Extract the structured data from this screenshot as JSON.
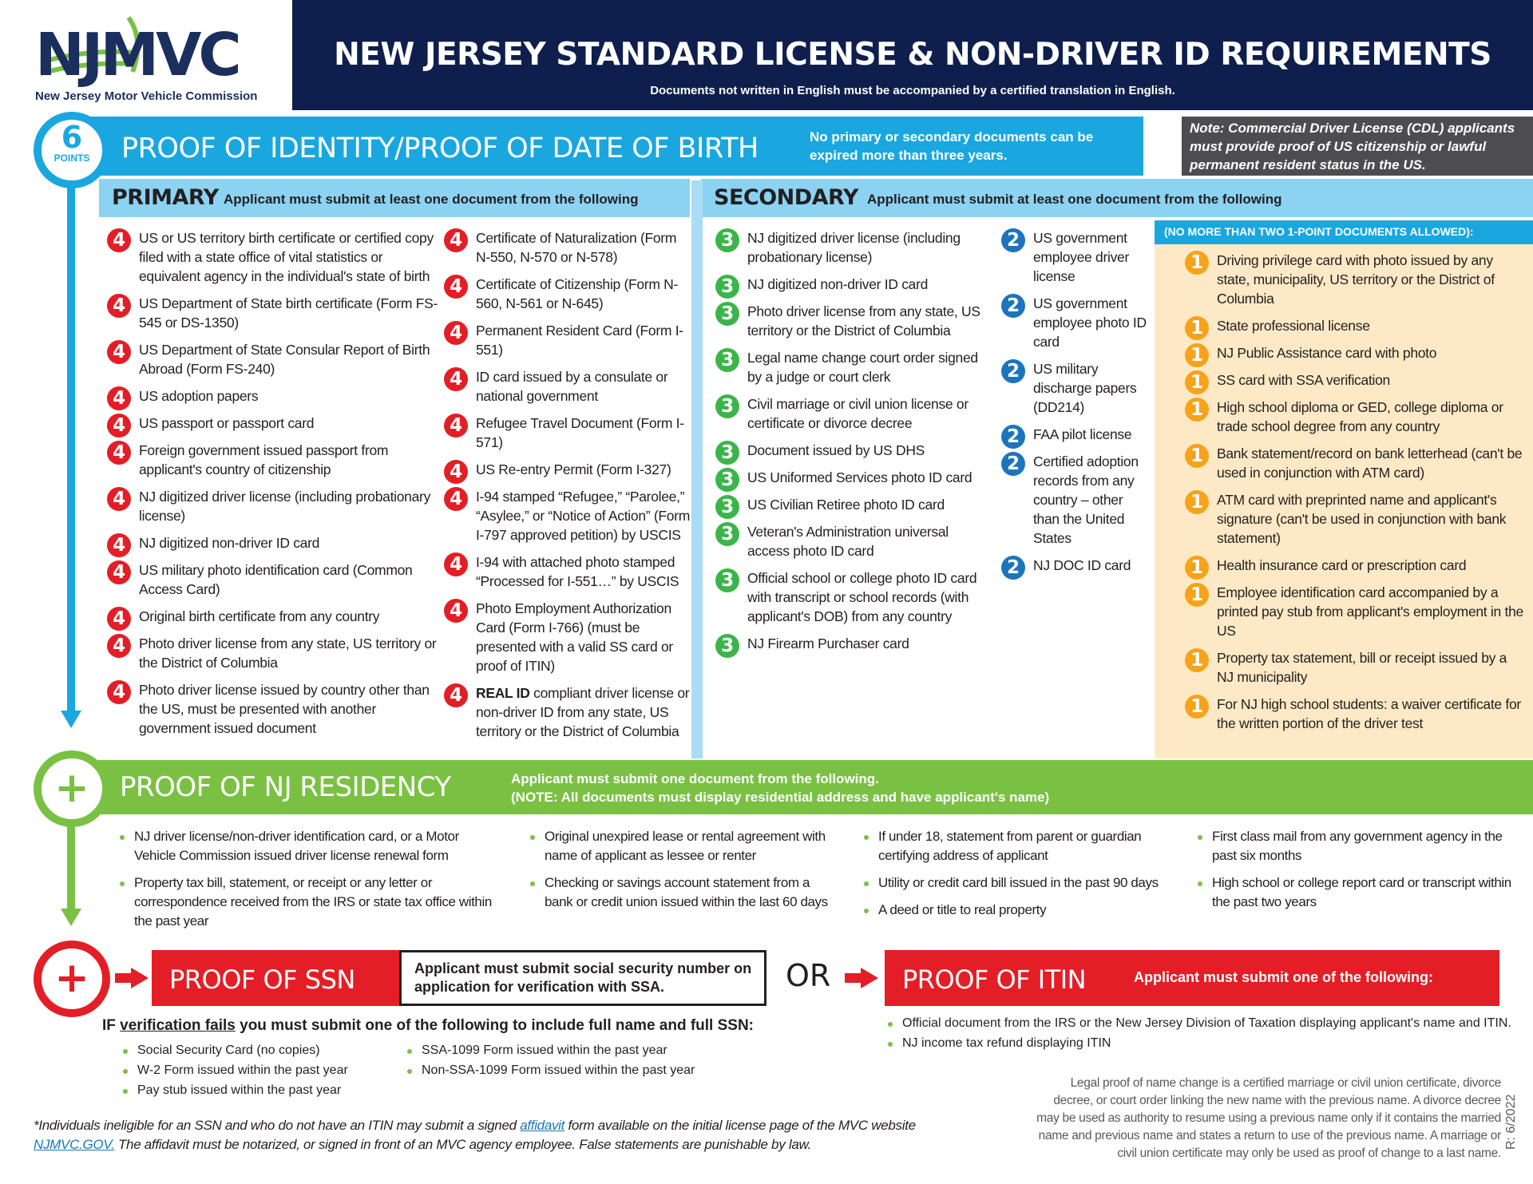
{
  "header": {
    "logo_text": "NJMVC",
    "logo_subtitle": "New Jersey Motor Vehicle Commission",
    "title": "NEW JERSEY STANDARD LICENSE & NON-DRIVER ID REQUIREMENTS",
    "subtitle": "Documents not written in English must be accompanied by a certified translation in English."
  },
  "colors": {
    "navy": "#0e1f4d",
    "identity_blue": "#1aa7e0",
    "light_blue": "#8cd3f3",
    "residency_green": "#7ac143",
    "ssn_red": "#e41e26",
    "one_point_bg": "#fde9c5",
    "note_gray": "#4d4d4f"
  },
  "identity": {
    "points_value": "6",
    "points_label": "POINTS",
    "title": "PROOF OF IDENTITY/PROOF OF DATE OF BIRTH",
    "note": "No primary or secondary documents can be expired more than three years.",
    "cdl_note": "Note: Commercial Driver License (CDL) applicants must provide proof of US citizenship or lawful permanent resident status in the US.",
    "primary": {
      "heading": "PRIMARY",
      "instruction": "Applicant must submit at least one document from the following",
      "col1": [
        {
          "points": "4",
          "text": "US or US territory birth certificate or certified copy filed with a state office of vital statistics or equivalent agency in the individual's state of birth"
        },
        {
          "points": "4",
          "text": "US Department of State birth certificate (Form FS-545 or DS-1350)"
        },
        {
          "points": "4",
          "text": "US Department of State Consular Report of Birth Abroad (Form FS-240)"
        },
        {
          "points": "4",
          "text": "US adoption papers"
        },
        {
          "points": "4",
          "text": "US passport or passport card"
        },
        {
          "points": "4",
          "text": "Foreign government issued passport from applicant's country of citizenship"
        },
        {
          "points": "4",
          "text": "NJ digitized driver license (including probationary license)"
        },
        {
          "points": "4",
          "text": "NJ digitized non-driver ID card"
        },
        {
          "points": "4",
          "text": "US military photo identification card (Common Access Card)"
        },
        {
          "points": "4",
          "text": "Original birth certificate from any country"
        },
        {
          "points": "4",
          "text": "Photo driver license from any state, US territory or the District of Columbia"
        },
        {
          "points": "4",
          "text": "Photo driver license issued by country other than the US, must be presented with another government issued document"
        }
      ],
      "col2": [
        {
          "points": "4",
          "text": "Certificate of Naturalization (Form N-550, N-570 or N-578)"
        },
        {
          "points": "4",
          "text": "Certificate of Citizenship (Form N-560, N-561 or N-645)"
        },
        {
          "points": "4",
          "text": "Permanent Resident Card (Form I-551)"
        },
        {
          "points": "4",
          "text": "ID card issued by a consulate or national government"
        },
        {
          "points": "4",
          "text": "Refugee Travel Document (Form I-571)"
        },
        {
          "points": "4",
          "text": "US Re-entry Permit (Form I-327)"
        },
        {
          "points": "4",
          "text": "I-94 stamped “Refugee,” “Parolee,” “Asylee,” or “Notice of Action” (Form I-797 approved petition) by USCIS"
        },
        {
          "points": "4",
          "text": "I-94 with attached photo stamped “Processed for I-551…” by USCIS"
        },
        {
          "points": "4",
          "text": "Photo Employment Authorization Card (Form I-766) (must be presented with a valid SS card or proof of ITIN)"
        },
        {
          "points": "4",
          "bold_prefix": "REAL ID",
          "text": " compliant driver license or non-driver ID from any state, US territory or the District of Columbia"
        }
      ]
    },
    "secondary": {
      "heading": "SECONDARY",
      "instruction": "Applicant must submit at least one document from the following",
      "three_point": [
        {
          "points": "3",
          "text": "NJ digitized driver license (including probationary license)"
        },
        {
          "points": "3",
          "text": "NJ digitized non-driver ID card"
        },
        {
          "points": "3",
          "text": "Photo driver license from any state, US territory or the District of Columbia"
        },
        {
          "points": "3",
          "text": "Legal name change court order signed by a judge or court clerk"
        },
        {
          "points": "3",
          "text": "Civil marriage or civil union license or certificate or divorce decree"
        },
        {
          "points": "3",
          "text": "Document issued by US DHS"
        },
        {
          "points": "3",
          "text": "US Uniformed Services photo ID card"
        },
        {
          "points": "3",
          "text": "US Civilian Retiree photo ID card"
        },
        {
          "points": "3",
          "text": "Veteran's Administration universal access photo ID card"
        },
        {
          "points": "3",
          "text": "Official school or college photo ID card with transcript or school records (with applicant's DOB) from any country"
        },
        {
          "points": "3",
          "text": "NJ Firearm Purchaser card"
        }
      ],
      "two_point": [
        {
          "points": "2",
          "text": "US government employee driver license"
        },
        {
          "points": "2",
          "text": "US government employee photo ID card"
        },
        {
          "points": "2",
          "text": "US military discharge papers (DD214)"
        },
        {
          "points": "2",
          "text": "FAA pilot license"
        },
        {
          "points": "2",
          "text": "Certified adoption records from any country – other than the United States"
        },
        {
          "points": "2",
          "text": "NJ DOC ID card"
        }
      ],
      "one_point_header": "(NO MORE THAN TWO 1-POINT DOCUMENTS ALLOWED):",
      "one_point": [
        {
          "points": "1",
          "text": "Driving privilege card with photo issued by any state, municipality, US territory or the District of Columbia"
        },
        {
          "points": "1",
          "text": "State professional license"
        },
        {
          "points": "1",
          "text": "NJ Public Assistance card with photo"
        },
        {
          "points": "1",
          "text": "SS card with SSA verification"
        },
        {
          "points": "1",
          "text": "High school diploma or GED, college diploma or trade school degree from any country"
        },
        {
          "points": "1",
          "text": "Bank statement/record on bank letterhead (can't be used in conjunction with ATM card)"
        },
        {
          "points": "1",
          "text": "ATM card with preprinted name and applicant's signature (can't be used in conjunction with bank statement)"
        },
        {
          "points": "1",
          "text": "Health insurance card or prescription card"
        },
        {
          "points": "1",
          "text": "Employee identification card accompanied by a printed pay stub from applicant's employment in the US"
        },
        {
          "points": "1",
          "text": "Property tax statement, bill or receipt issued by a NJ municipality"
        },
        {
          "points": "1",
          "text": "For NJ high school students: a waiver certificate for the written portion of the driver test"
        }
      ]
    }
  },
  "residency": {
    "icon": "+",
    "title": "PROOF OF NJ RESIDENCY",
    "note_line1": "Applicant must submit one document from the following.",
    "note_line2": "(NOTE:  All documents must display residential address and have applicant's name)",
    "columns": [
      [
        "NJ driver license/non-driver identification card, or a Motor Vehicle Commission issued driver license renewal form",
        "Property tax bill, statement, or receipt or any letter or correspondence received from the IRS or state tax office within the past year"
      ],
      [
        "Original unexpired lease or rental agreement with name of applicant as lessee or renter",
        "Checking or savings account statement from a bank or credit union issued within the last 60 days"
      ],
      [
        "If under 18, statement from parent or guardian certifying address of applicant",
        "Utility or credit card bill issued in the past 90 days",
        "A deed or title to real property"
      ],
      [
        "First class mail from any government agency in the past six months",
        "High school or college report card or transcript within the past two years"
      ]
    ]
  },
  "ssn": {
    "icon": "+",
    "title": "PROOF OF SSN",
    "instruction": "Applicant must submit social security number on application for verification with SSA.",
    "if_prefix": "IF ",
    "if_underlined": "verification fails",
    "if_suffix": " you must submit one of the following to include full name and full SSN:",
    "list_col1": [
      "Social Security Card (no copies)",
      "W-2 Form issued within the  past year",
      "Pay stub issued within the past year"
    ],
    "list_col2": [
      "SSA-1099 Form issued within the past year",
      "Non-SSA-1099 Form issued within the past year"
    ]
  },
  "or_label": "OR",
  "itin": {
    "title": "PROOF OF ITIN",
    "instruction": "Applicant must submit one of the following:",
    "list": [
      "Official document from the IRS or the New Jersey Division of Taxation displaying applicant's name and ITIN.",
      "NJ income tax refund displaying ITIN"
    ]
  },
  "footer": {
    "part1": "*Individuals ineligible for an SSN and who do not have an ITIN may submit a signed ",
    "affidavit_link": "affidavit",
    "part2": " form available on the initial license page of the MVC website ",
    "site_link": "NJMVC.GOV.",
    "part3": " The affidavit must be notarized, or signed in front of an MVC agency employee. False statements are punishable by law.",
    "legal_note": "Legal proof of name change is a certified marriage or civil union certificate, divorce decree, or court order linking the new name with the previous name. A divorce decree may be used as authority to resume using a previous name only if it contains the married name and previous name and states a return to use of the previous name. A marriage or civil union certificate may only be used as proof of change to a last name.",
    "revision": "R: 6/2022"
  }
}
